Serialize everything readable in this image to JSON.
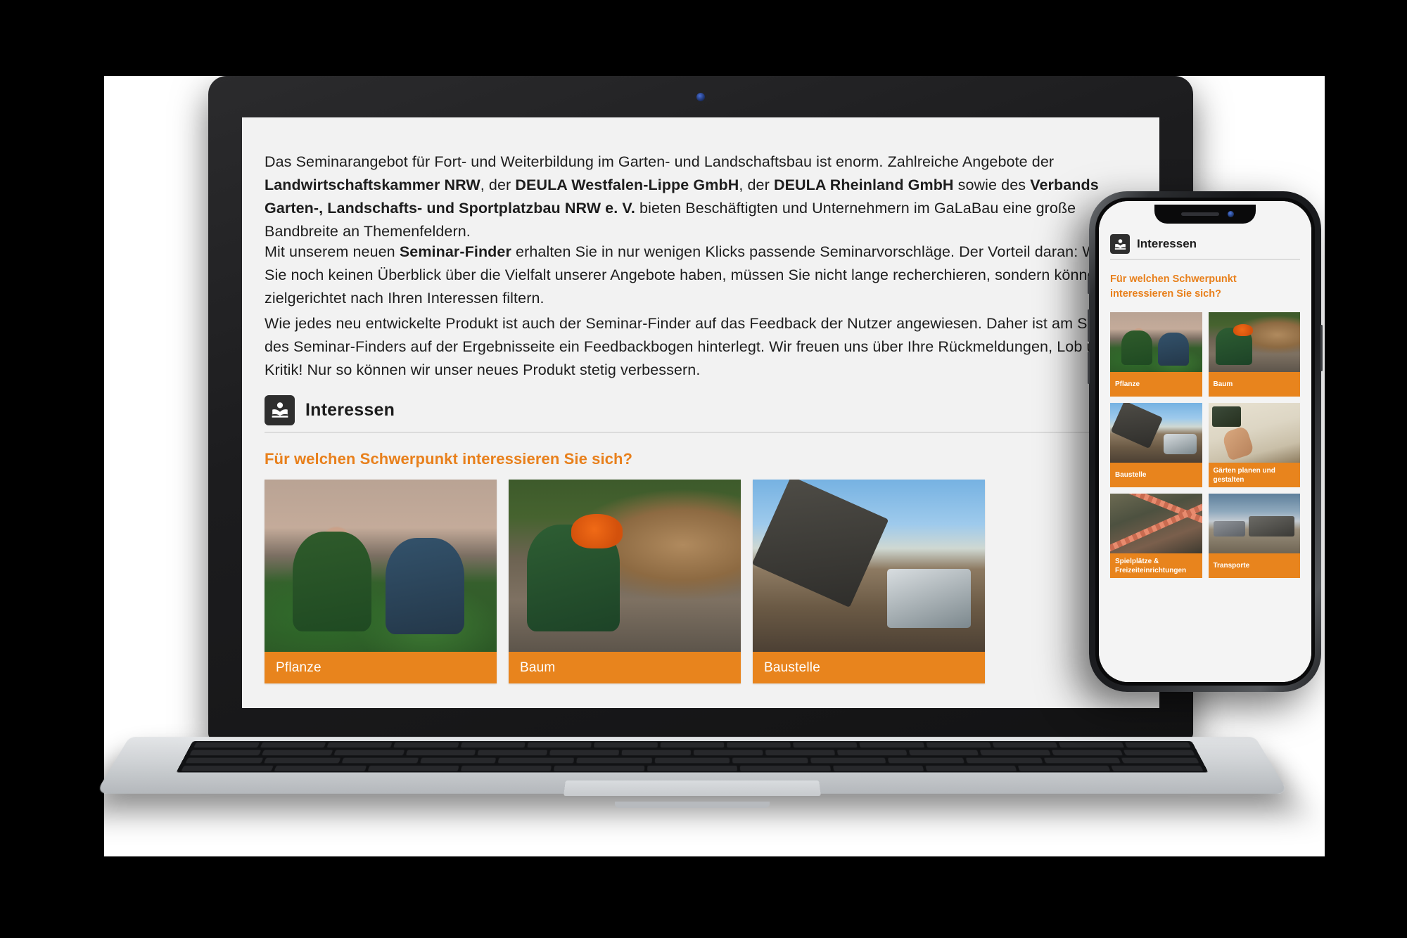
{
  "article": {
    "paragraphs": [
      {
        "id": "p1",
        "runs": [
          {
            "text": "Das Seminarangebot für Fort- und Weiterbildung im Garten- und Landschaftsbau ist enorm. Zahlreiche Angebote der ",
            "bold": false
          },
          {
            "text": "Landwirtschaftskammer NRW",
            "bold": true
          },
          {
            "text": ", der ",
            "bold": false
          },
          {
            "text": "DEULA Westfalen-Lippe GmbH",
            "bold": true
          },
          {
            "text": ", der ",
            "bold": false
          },
          {
            "text": "DEULA Rheinland GmbH",
            "bold": true
          },
          {
            "text": " sowie des ",
            "bold": false
          },
          {
            "text": "Verbands Garten-, Landschafts- und Sportplatzbau NRW e. V.",
            "bold": true
          },
          {
            "text": " bieten Beschäftigten und Unternehmern im GaLaBau eine große Bandbreite an Themenfeldern.",
            "bold": false
          }
        ]
      },
      {
        "id": "p2",
        "runs": [
          {
            "text": "Mit unserem neuen ",
            "bold": false
          },
          {
            "text": "Seminar-Finder",
            "bold": true
          },
          {
            "text": " erhalten Sie in nur wenigen Klicks passende Seminarvorschläge. Der Vorteil daran: Wenn Sie noch keinen Überblick über die Vielfalt unserer Angebote haben, müssen Sie nicht lange recherchieren, sondern können zielgerichtet nach Ihren Interessen filtern.",
            "bold": false
          }
        ]
      },
      {
        "id": "p3",
        "runs": [
          {
            "text": "Wie jedes neu entwickelte Produkt ist auch der Seminar-Finder auf das Feedback der Nutzer angewiesen. Daher ist am Schluss des Seminar-Finders auf der Ergebnisseite ein Feedbackbogen hinterlegt. Wir freuen uns über Ihre Rückmeldungen, Lob und Kritik! Nur so können wir unser neues Produkt stetig verbessern.",
            "bold": false
          }
        ]
      }
    ]
  },
  "module": {
    "icon_name": "person-reading-book-icon",
    "title": "Interessen",
    "question": "Für welchen Schwerpunkt interessieren Sie sich?",
    "accent_color": "#e8841d",
    "question_color": "#e8801c",
    "header_icon_bg": "#2e2e2e",
    "background": "#f2f2f2",
    "cards": [
      {
        "label": "Pflanze",
        "photo": "two-gardeners-planting"
      },
      {
        "label": "Baum",
        "photo": "worker-chainsaw-logs"
      },
      {
        "label": "Baustelle",
        "photo": "excavator-digging-soil"
      }
    ]
  },
  "phone": {
    "icon_name": "person-reading-book-icon",
    "title": "Interessen",
    "question": "Für welchen Schwerpunkt interessieren Sie sich?",
    "cards": [
      {
        "label": "Pflanze",
        "photo": "two-gardeners-planting"
      },
      {
        "label": "Baum",
        "photo": "worker-chainsaw-logs"
      },
      {
        "label": "Baustelle",
        "photo": "excavator-tree-stump"
      },
      {
        "label": "Gärten planen und gestalten",
        "photo": "hand-drawing-garden-plan"
      },
      {
        "label": "Spielplätze & Freizeiteinrichtungen",
        "photo": "playground-rope-climbing-net"
      },
      {
        "label": "Transporte",
        "photo": "dump-truck-construction"
      }
    ]
  }
}
